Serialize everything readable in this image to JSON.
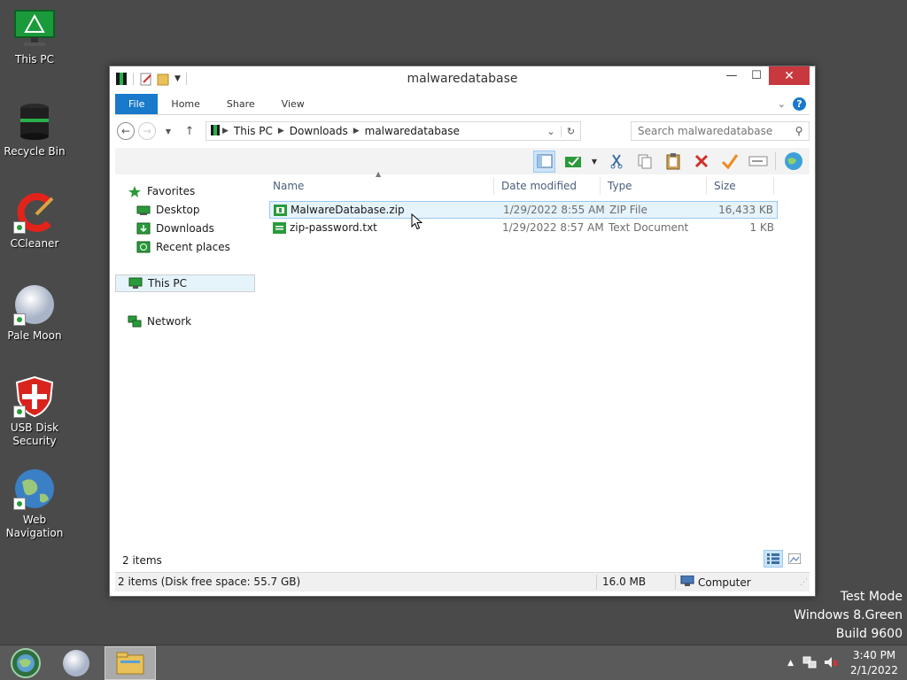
{
  "desktop": {
    "icons": [
      {
        "label": "This PC"
      },
      {
        "label": "Recycle Bin"
      },
      {
        "label": "CCleaner"
      },
      {
        "label": "Pale Moon"
      },
      {
        "label": "USB Disk Security"
      },
      {
        "label": "Web Navigation"
      }
    ]
  },
  "window": {
    "title": "malwaredatabase",
    "close_glyph": "✕",
    "maximize_glyph": "☐",
    "minimize_glyph": "—"
  },
  "ribbon": {
    "tabs": [
      "File",
      "Home",
      "Share",
      "View"
    ],
    "help_glyph": "?"
  },
  "address": {
    "crumbs": [
      "This PC",
      "Downloads",
      "malwaredatabase"
    ]
  },
  "search": {
    "placeholder": "Search malwaredatabase"
  },
  "nav_pane": {
    "favorites": "Favorites",
    "desktop": "Desktop",
    "downloads": "Downloads",
    "recent": "Recent places",
    "this_pc": "This PC",
    "network": "Network"
  },
  "columns": {
    "name": "Name",
    "date": "Date modified",
    "type": "Type",
    "size": "Size"
  },
  "files": [
    {
      "name": "MalwareDatabase.zip",
      "date": "1/29/2022 8:55 AM",
      "type": "ZIP File",
      "size": "16,433 KB",
      "selected": true
    },
    {
      "name": "zip-password.txt",
      "date": "1/29/2022 8:57 AM",
      "type": "Text Document",
      "size": "1 KB",
      "selected": false
    }
  ],
  "status": {
    "items_count": "2 items",
    "summary": "2 items (Disk free space: 55.7 GB)",
    "size": "16.0 MB",
    "location": "Computer"
  },
  "watermark": {
    "line1": "Test Mode",
    "line2": "Windows 8.Green",
    "line3": "Build 9600"
  },
  "clock": {
    "time": "3:40 PM",
    "date": "2/1/2022"
  },
  "colors": {
    "accent": "#1979ca",
    "close": "#c7393e",
    "selection": "#e5f3fb"
  }
}
